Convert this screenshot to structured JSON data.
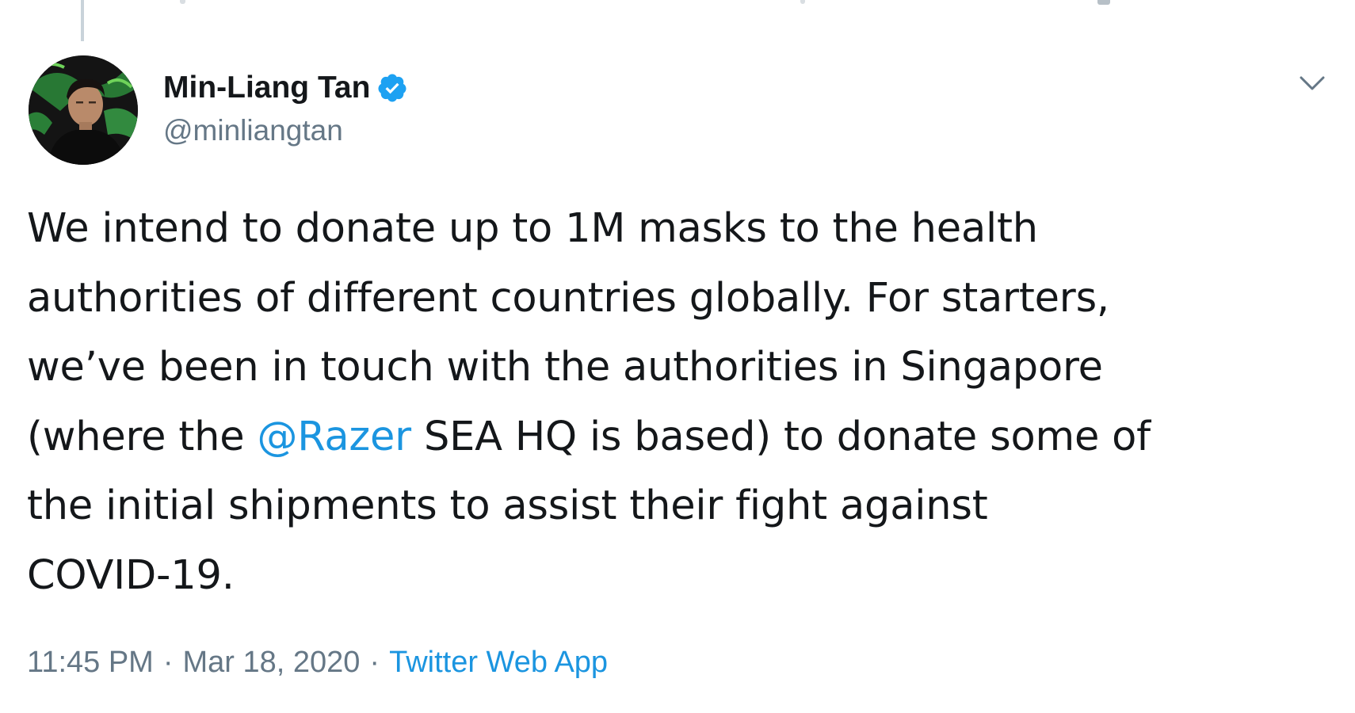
{
  "tweet": {
    "author": {
      "display_name": "Min-Liang Tan",
      "handle": "@minliangtan",
      "verified": true,
      "avatar_icon": "profile-photo"
    },
    "text_lines": [
      [
        {
          "text": "We intend to donate up to 1M masks to the health"
        }
      ],
      [
        {
          "text": "authorities of different countries globally. For starters,"
        }
      ],
      [
        {
          "text": "we’ve been in touch with the authorities in Singapore"
        }
      ],
      [
        {
          "text": "(where the "
        },
        {
          "text": "@Razer",
          "mention": true
        },
        {
          "text": " SEA HQ is based) to donate some of"
        }
      ],
      [
        {
          "text": "the initial shipments to assist their fight against"
        }
      ],
      [
        {
          "text": "COVID-19."
        }
      ]
    ],
    "time": "11:45 PM",
    "date": "Mar 18, 2020",
    "separator": "·",
    "source": "Twitter Web App",
    "menu_icon": "chevron-down-icon"
  },
  "colors": {
    "link": "#1b95e0",
    "text": "#14171a",
    "secondary": "#657786",
    "verified": "#1da1f2",
    "background": "#ffffff"
  }
}
